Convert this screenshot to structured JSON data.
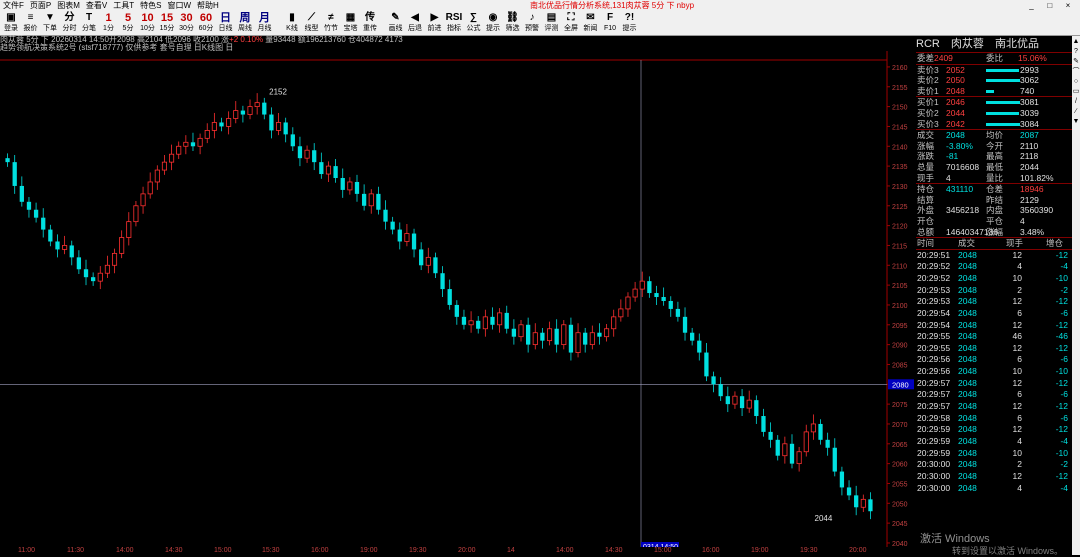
{
  "window": {
    "menus": [
      "文件F",
      "页面P",
      "图表M",
      "查看V",
      "工具T",
      "特色S",
      "窗口W",
      "帮助H"
    ],
    "title": "南北优品行情分析系统,131肉苁蓉 5分 下 nbyp",
    "controls": [
      "_",
      "□",
      "×"
    ]
  },
  "toolbar": [
    {
      "icon": "monitor-icon",
      "glyph": "▣",
      "label": "登录"
    },
    {
      "icon": "price-icon",
      "glyph": "≡",
      "label": "报价"
    },
    {
      "icon": "down-icon",
      "glyph": "▼",
      "label": "下单"
    },
    {
      "icon": "fenshi-icon",
      "glyph": "分",
      "label": "分时"
    },
    {
      "icon": "fenbi-icon",
      "glyph": "T",
      "label": "分笔"
    },
    {
      "icon": "p1-icon",
      "glyph": "1",
      "label": "1分"
    },
    {
      "icon": "p5-icon",
      "glyph": "5",
      "label": "5分"
    },
    {
      "icon": "p10-icon",
      "glyph": "10",
      "label": "10分"
    },
    {
      "icon": "p15-icon",
      "glyph": "15",
      "label": "15分"
    },
    {
      "icon": "p30-icon",
      "glyph": "30",
      "label": "30分"
    },
    {
      "icon": "p60-icon",
      "glyph": "60",
      "label": "60分"
    },
    {
      "icon": "day-icon",
      "glyph": "日",
      "label": "日线"
    },
    {
      "icon": "week-icon",
      "glyph": "周",
      "label": "周线"
    },
    {
      "icon": "month-icon",
      "glyph": "月",
      "label": "月线"
    },
    {
      "icon": "kline-icon",
      "glyph": "▮",
      "label": "K线"
    },
    {
      "icon": "segment-icon",
      "glyph": "⟋",
      "label": "线型"
    },
    {
      "icon": "tick-icon",
      "glyph": "≠",
      "label": "竹节"
    },
    {
      "icon": "baota-icon",
      "glyph": "▦",
      "label": "宝塔"
    },
    {
      "icon": "chuan-icon",
      "glyph": "传",
      "label": "重传"
    },
    {
      "icon": "draw-icon",
      "glyph": "✎",
      "label": "画线"
    },
    {
      "icon": "back-icon",
      "glyph": "◀",
      "label": "后退"
    },
    {
      "icon": "forward-icon",
      "glyph": "▶",
      "label": "前进"
    },
    {
      "icon": "rsi-icon",
      "glyph": "RSI",
      "label": "指标"
    },
    {
      "icon": "formula-icon",
      "glyph": "∑",
      "label": "公式"
    },
    {
      "icon": "tip-icon",
      "glyph": "◉",
      "label": "提示"
    },
    {
      "icon": "filter-icon",
      "glyph": "⛓",
      "label": "筛选"
    },
    {
      "icon": "alert-icon",
      "glyph": "♪",
      "label": "预警"
    },
    {
      "icon": "eval-icon",
      "glyph": "▤",
      "label": "评测"
    },
    {
      "icon": "fullscreen-icon",
      "glyph": "⛶",
      "label": "全屏"
    },
    {
      "icon": "news-icon",
      "glyph": "✉",
      "label": "新闻"
    },
    {
      "icon": "f10-icon",
      "glyph": "F",
      "label": "F10"
    },
    {
      "icon": "help-icon",
      "glyph": "?!",
      "label": "提示"
    }
  ],
  "info": {
    "line1_prefix": "肉苁蓉 5分 下 20260314 14:50开2098 高2104 低2096 收2100 涨",
    "line1_pct": "+2 0.10%",
    "line1_suffix": " 量93448 额196213760 仓404872 4173",
    "line2": "趋势领航决策系统2号 (stsf718777) 仅供参考 套号自理 日K线图 日"
  },
  "chart_data": {
    "type": "candlestick",
    "yaxis": {
      "min": 2041,
      "max": 2162,
      "ticks": [
        2160,
        2155,
        2150,
        2145,
        2140,
        2135,
        2130,
        2125,
        2120,
        2115,
        2110,
        2105,
        2100,
        2095,
        2090,
        2085,
        2080,
        2075,
        2070,
        2065,
        2060,
        2055,
        2050,
        2045,
        2040
      ]
    },
    "crosshair_price": "2080",
    "crosshair_time": "0314 14:50",
    "annotations": [
      {
        "text": "2152"
      },
      {
        "text": "2044"
      }
    ],
    "closes": [
      2136,
      2130,
      2126,
      2124,
      2122,
      2119,
      2116,
      2114,
      2115,
      2112,
      2109,
      2107,
      2106,
      2108,
      2110,
      2113,
      2117,
      2121,
      2125,
      2128,
      2131,
      2134,
      2136,
      2138,
      2140,
      2141,
      2140,
      2142,
      2144,
      2146,
      2145,
      2147,
      2149,
      2148,
      2150,
      2151,
      2148,
      2144,
      2146,
      2143,
      2140,
      2137,
      2139,
      2136,
      2133,
      2135,
      2132,
      2129,
      2131,
      2128,
      2125,
      2128,
      2124,
      2121,
      2119,
      2116,
      2118,
      2114,
      2110,
      2112,
      2108,
      2104,
      2100,
      2097,
      2095,
      2096,
      2094,
      2097,
      2095,
      2098,
      2094,
      2092,
      2095,
      2090,
      2093,
      2091,
      2094,
      2090,
      2095,
      2088,
      2093,
      2090,
      2093,
      2092,
      2094,
      2097,
      2099,
      2102,
      2104,
      2106,
      2103,
      2102,
      2101,
      2099,
      2097,
      2093,
      2091,
      2088,
      2082,
      2080,
      2077,
      2075,
      2077,
      2074,
      2076,
      2072,
      2068,
      2066,
      2062,
      2065,
      2060,
      2063,
      2068,
      2070,
      2066,
      2064,
      2058,
      2054,
      2052,
      2049,
      2051,
      2048
    ],
    "time_labels": [
      "11:00",
      "11:30",
      "14:00",
      "14:30",
      "15:00",
      "15:30",
      "16:00",
      "19:00",
      "19:30",
      "20:00",
      "14",
      "14:00",
      "14:30",
      "15:00",
      "16:00",
      "19:00",
      "19:30",
      "20:00"
    ],
    "legend": "",
    "xlabel": "",
    "ylabel": ""
  },
  "quote": {
    "header": {
      "code": "RCR",
      "name": "肉苁蓉",
      "brand": "南北优品"
    },
    "weicha": {
      "label": "委差",
      "value": "2409"
    },
    "weibi": {
      "label": "委比",
      "value": "15.06%"
    },
    "asks": [
      {
        "label": "卖价3",
        "price": "2052",
        "vol": "2993",
        "bar": 0.97
      },
      {
        "label": "卖价2",
        "price": "2050",
        "vol": "3062",
        "bar": 1.0
      },
      {
        "label": "卖价1",
        "price": "2048",
        "vol": "740",
        "bar": 0.24
      }
    ],
    "bids": [
      {
        "label": "买价1",
        "price": "2046",
        "vol": "3081",
        "bar": 1.0
      },
      {
        "label": "买价2",
        "price": "2044",
        "vol": "3039",
        "bar": 0.98
      },
      {
        "label": "买价3",
        "price": "2042",
        "vol": "3084",
        "bar": 1.0
      }
    ],
    "stats": [
      [
        "成交",
        "2048",
        "均价",
        "2087"
      ],
      [
        "涨幅",
        "-3.80%",
        "今开",
        "2110"
      ],
      [
        "涨跌",
        "-81",
        "最高",
        "2118"
      ],
      [
        "总量",
        "7016608",
        "最低",
        "2044"
      ],
      [
        "现手",
        "4",
        "量比",
        "101.82%"
      ]
    ],
    "stats2": [
      [
        "持仓",
        "431110",
        "仓差",
        "18946"
      ],
      [
        "结算",
        "",
        "昨结",
        "2129"
      ],
      [
        "外盘",
        "3456218",
        "内盘",
        "3560390"
      ],
      [
        "开仓",
        "",
        "平仓",
        "4"
      ],
      [
        "总额",
        "14640347136",
        "涨幅",
        "3.48%"
      ]
    ],
    "tick_header": {
      "time": "时间",
      "price": "成交",
      "vol": "现手",
      "delta": "增仓"
    },
    "ticks": [
      [
        "20:29:51",
        "2048",
        "12",
        "-12"
      ],
      [
        "20:29:52",
        "2048",
        "4",
        "-4"
      ],
      [
        "20:29:52",
        "2048",
        "10",
        "-10"
      ],
      [
        "20:29:53",
        "2048",
        "2",
        "-2"
      ],
      [
        "20:29:53",
        "2048",
        "12",
        "-12"
      ],
      [
        "20:29:54",
        "2048",
        "6",
        "-6"
      ],
      [
        "20:29:54",
        "2048",
        "12",
        "-12"
      ],
      [
        "20:29:55",
        "2048",
        "46",
        "-46"
      ],
      [
        "20:29:55",
        "2048",
        "12",
        "-12"
      ],
      [
        "20:29:56",
        "2048",
        "6",
        "-6"
      ],
      [
        "20:29:56",
        "2048",
        "10",
        "-10"
      ],
      [
        "20:29:57",
        "2048",
        "12",
        "-12"
      ],
      [
        "20:29:57",
        "2048",
        "6",
        "-6"
      ],
      [
        "20:29:57",
        "2048",
        "12",
        "-12"
      ],
      [
        "20:29:58",
        "2048",
        "6",
        "-6"
      ],
      [
        "20:29:59",
        "2048",
        "12",
        "-12"
      ],
      [
        "20:29:59",
        "2048",
        "4",
        "-4"
      ],
      [
        "20:29:59",
        "2048",
        "10",
        "-10"
      ],
      [
        "20:30:00",
        "2048",
        "2",
        "-2"
      ],
      [
        "20:30:00",
        "2048",
        "12",
        "-12"
      ],
      [
        "20:30:00",
        "2048",
        "4",
        "-4"
      ]
    ]
  },
  "watermark": {
    "line1": "激活 Windows",
    "line2": "转到设置以激活 Windows。"
  },
  "colors": {
    "up": "#ff3030",
    "down": "#00e0e0",
    "grid": "#800000",
    "bg": "#000000"
  }
}
